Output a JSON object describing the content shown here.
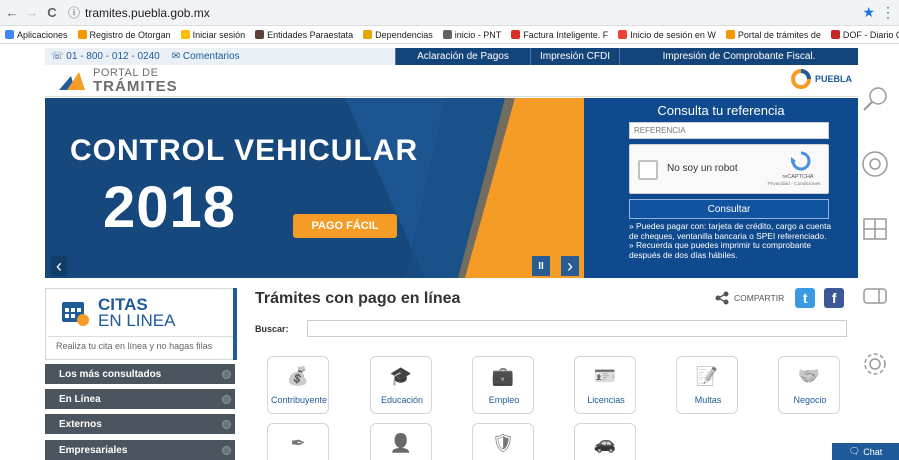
{
  "browser": {
    "back": "←",
    "forward": "→",
    "reload": "C",
    "info": "ⓘ",
    "url": "tramites.puebla.gob.mx",
    "star": "★",
    "menu": "⋮"
  },
  "bookmarks": [
    {
      "label": "Aplicaciones",
      "color": "#4285f4"
    },
    {
      "label": "Registro de Otorgan",
      "color": "#f29900"
    },
    {
      "label": "Iniciar sesión",
      "color": "#fbbc04"
    },
    {
      "label": "Entidades Paraestata",
      "color": "#5d4037"
    },
    {
      "label": "Dependencias",
      "color": "#e8a400"
    },
    {
      "label": "inicio - PNT",
      "color": "#5f6368"
    },
    {
      "label": "Factura Inteligente. F",
      "color": "#d93025"
    },
    {
      "label": "Inicio de sesión en W",
      "color": "#ea4335"
    },
    {
      "label": "Portal de trámites de",
      "color": "#f29900"
    },
    {
      "label": "DOF - Diario Oficial d",
      "color": "#c62828"
    }
  ],
  "site": {
    "phone": "01 - 800 - 012 - 0240",
    "comments": "Comentarios",
    "nav": [
      "Aclaración de Pagos",
      "Impresión CFDI",
      "Impresión de Comprobante Fiscal."
    ],
    "logo_line1": "PORTAL DE",
    "logo_line2": "TRÁMITES",
    "puebla_logo": "PUEBLA",
    "colors": {
      "navy": "#14457a",
      "orange": "#f59c27",
      "blue": "#1f5a99"
    }
  },
  "hero": {
    "title": "CONTROL VEHICULAR",
    "year": "2018",
    "button": "PAGO FÁCIL",
    "prev": "‹",
    "pause": "II",
    "next": "›"
  },
  "consulta": {
    "title": "Consulta tu referencia",
    "placeholder": "REFERENCIA",
    "captcha_label": "No soy un robot",
    "captcha_brand": "reCAPTCHA",
    "captcha_links": "Privacidad - Condiciones",
    "button": "Consultar",
    "note1": "» Puedes pagar con: tarjeta de crédito, cargo a cuenta de cheques, ventanilla bancaria o SPEI referenciado.",
    "note2": "» Recuerda que puedes imprimir tu comprobante después de dos días hábiles."
  },
  "citas": {
    "title1": "CITAS",
    "title2": "EN LINEA",
    "subtitle": "Realiza tu cita en línea y no hagas filas"
  },
  "sidebar": [
    "Los más consultados",
    "En Línea",
    "Externos",
    "Empresariales"
  ],
  "main": {
    "title": "Trámites con pago en línea",
    "share": "COMPARTIR",
    "twitter": "t",
    "facebook": "f",
    "search_label": "Buscar:"
  },
  "tiles": [
    {
      "label": "Contribuyente",
      "icon": "contribuyente-icon"
    },
    {
      "label": "Educación",
      "icon": "educacion-icon"
    },
    {
      "label": "Empleo",
      "icon": "empleo-icon"
    },
    {
      "label": "Licencias",
      "icon": "licencias-icon"
    },
    {
      "label": "Multas",
      "icon": "multas-icon"
    },
    {
      "label": "Negocio",
      "icon": "negocio-icon"
    },
    {
      "label": "",
      "icon": "feather-icon"
    },
    {
      "label": "",
      "icon": "person-icon"
    },
    {
      "label": "",
      "icon": "badge-icon"
    },
    {
      "label": "",
      "icon": "car-icon"
    }
  ],
  "chat": "Chat"
}
